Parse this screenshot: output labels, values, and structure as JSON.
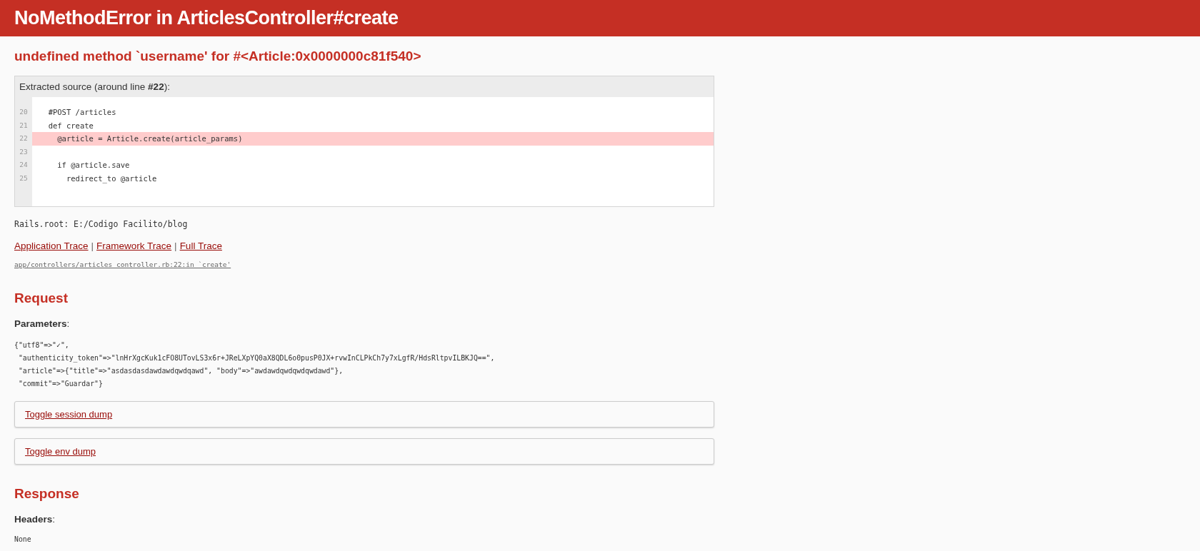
{
  "header": {
    "title": "NoMethodError in ArticlesController#create"
  },
  "error_message": "undefined method `username' for #<Article:0x0000000c81f540>",
  "source": {
    "caption": "Extracted source (around line **#22**):",
    "lines": [
      {
        "number": "20",
        "code": "  #POST /articles",
        "highlighted": false
      },
      {
        "number": "21",
        "code": "  def create",
        "highlighted": false
      },
      {
        "number": "22",
        "code": "    @article = Article.create(article_params)",
        "highlighted": true
      },
      {
        "number": "23",
        "highlighted": false
      },
      {
        "number": "24",
        "code": "    if @article.save",
        "highlighted": false
      },
      {
        "number": "25",
        "code": "      redirect_to @article",
        "highlighted": false
      }
    ]
  },
  "rails_root": "Rails.root: E:/Codigo Facilito/blog",
  "trace_links": [
    {
      "kind": "link",
      "text": "Application Trace"
    },
    {
      "kind": "separator",
      "text": "|"
    },
    {
      "kind": "link",
      "text": "Framework Trace"
    },
    {
      "kind": "separator",
      "text": "|"
    },
    {
      "kind": "link",
      "text": "Full Trace"
    }
  ],
  "trace_line": "app/controllers/articles_controller.rb:22:in `create'",
  "request": {
    "heading": "Request",
    "parameters_label": "Parameters",
    "parameters_colon": ":",
    "parameters": [
      "{\"utf8\"=>\"✓\",",
      " \"authenticity_token\"=>\"lnHrXgcKuk1cFO8UTovLS3x6r+JReLXpYQ0aX8QDL6o0pusP0JX+rvwInCLPkCh7y7xLgfR/HdsRltpvILBKJQ==\",",
      " \"article\"=>{\"title\"=>\"asdasdasdawdawdqwdqawd\", \"body\"=>\"awdawdqwdqwdqwdawd\"},",
      " \"commit\"=>\"Guardar\"}"
    ],
    "toggles": [
      "Toggle session dump",
      "Toggle env dump"
    ]
  },
  "response": {
    "heading": "Response",
    "headers_label": "Headers",
    "headers_colon": ":",
    "headers_value": "None"
  }
}
